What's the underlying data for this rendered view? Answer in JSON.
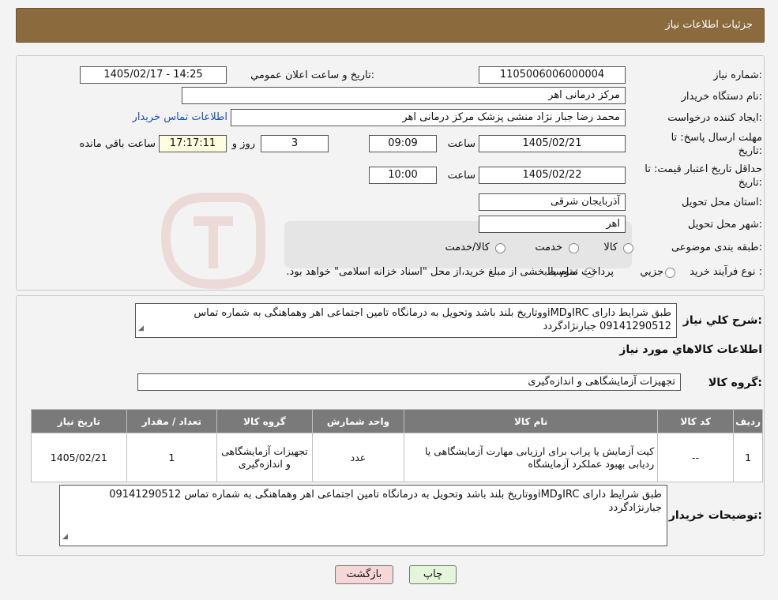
{
  "header": {
    "title": "جزئیات اطلاعات نیاز"
  },
  "form": {
    "need_number_label": "شماره نیاز:",
    "need_number": "1105006006000004",
    "announce_label": "تاریخ و ساعت اعلان عمومي:",
    "announce_value": "1405/02/17 - 14:25",
    "buyer_org_label": "نام دستگاه خريدار:",
    "buyer_org": "مرکز درمانی اهر",
    "requester_label": "ايجاد کننده درخواست:",
    "requester": "محمد رضا  جبار نژاد منشی پزشک  مرکز درمانی اهر",
    "contact_link": "اطلاعات تماس خریدار",
    "deadline_label_1": "مهلت ارسال پاسخ: تا",
    "deadline_label_2": "تاریخ:",
    "deadline_date": "1405/02/21",
    "time_label": "ساعت",
    "deadline_time": "09:09",
    "days_value": "3",
    "days_label": "روز و",
    "remaining_time": "17:17:11",
    "remaining_label": "ساعت باقي مانده",
    "validity_label_1": "حداقل تاريخ اعتبار قيمت: تا",
    "validity_label_2": "تاریخ:",
    "validity_date": "1405/02/22",
    "validity_time": "10:00",
    "province_label": "استان محل تحويل:",
    "province": "آذربايجان شرقی",
    "city_label": "شهر محل تحويل:",
    "city": "اهر",
    "category_label": "طبقه بندی موضوعی:",
    "category_options": [
      "کالا",
      "خدمت",
      "کالا/خدمت"
    ],
    "process_label": "نوع فرآيند خريد :",
    "process_options": [
      "جزيي",
      "متوسط"
    ],
    "process_note": "پرداخت تمام يا بخشی از مبلغ خريد،از محل \"اسناد خزانه اسلامی\" خواهد بود."
  },
  "summary": {
    "label": "شرح کلي نياز:",
    "text": "طبق شرایط دارای IRCوiMDووتاریخ بلند باشد وتحویل به درمانگاه تامین اجتماعی اهر وهماهنگی به شماره تماس 09141290512 جبارنژادگردد"
  },
  "goods": {
    "section_title": "اطلاعات کالاهاي مورد نياز",
    "group_label": "گروه کالا:",
    "group_value": "تجهیزات آزمایشگاهی و اندازه‌گیری",
    "columns": [
      "رديف",
      "کد کالا",
      "نام کالا",
      "واحد شمارش",
      "گروه کالا",
      "تعداد / مقدار",
      "تاريخ نياز"
    ],
    "rows": [
      {
        "row": "1",
        "code": "--",
        "name": "کیت آزمایش یا پراب برای ارزیابی مهارت آزمایشگاهی یا ردیابی بهبود عملکرد آزمایشگاه",
        "unit": "عدد",
        "group": "تجهیزات آزمایشگاهی و اندازه‌گیری",
        "qty": "1",
        "date": "1405/02/21"
      }
    ]
  },
  "buyer_notes": {
    "label": "توضيحات خريدار:",
    "text": "طبق شرایط دارای IRCوiMDووتاریخ بلند باشد وتحویل به درمانگاه تامین اجتماعی اهر وهماهنگی به شماره تماس 09141290512 جبارنژادگردد"
  },
  "buttons": {
    "print": "چاپ",
    "back": "بازگشت"
  },
  "colors": {
    "header_bg": "#8b6a3e",
    "table_header": "#7a7a7a",
    "back_button_bg": "#f6d6d6",
    "print_button_bg": "#e4f5d9"
  }
}
